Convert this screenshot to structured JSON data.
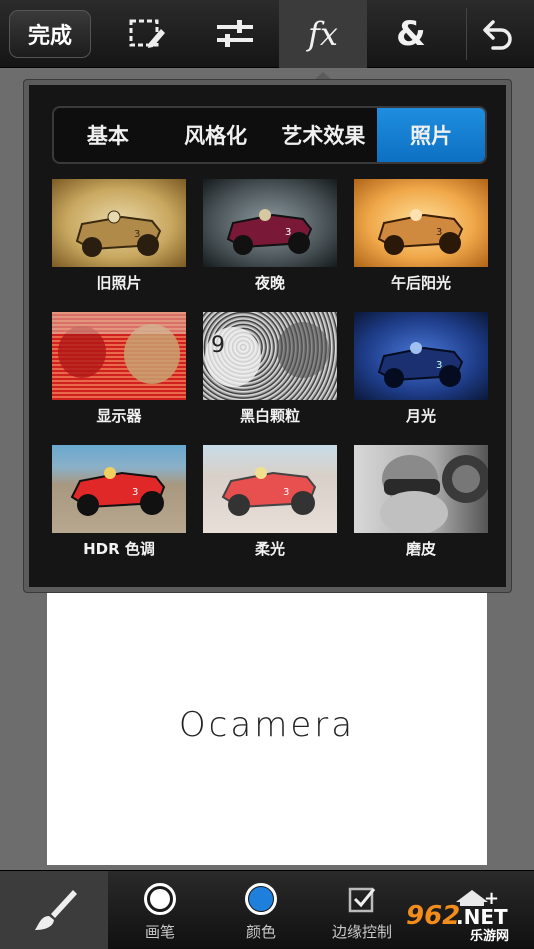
{
  "toolbar": {
    "done_label": "完成",
    "tools": [
      {
        "icon": "select-crop-icon",
        "active": false
      },
      {
        "icon": "adjust-sliders-icon",
        "active": false
      },
      {
        "icon": "fx-icon",
        "label": "fx",
        "active": true
      },
      {
        "icon": "ampersand-icon",
        "label": "&",
        "active": false
      },
      {
        "icon": "undo-icon",
        "active": false
      }
    ]
  },
  "popup": {
    "tabs": [
      {
        "label": "基本",
        "active": false
      },
      {
        "label": "风格化",
        "active": false
      },
      {
        "label": "艺术效果",
        "active": false
      },
      {
        "label": "照片",
        "active": true
      }
    ],
    "effects": [
      {
        "label": "旧照片"
      },
      {
        "label": "夜晚"
      },
      {
        "label": "午后阳光"
      },
      {
        "label": "显示器"
      },
      {
        "label": "黑白颗粒"
      },
      {
        "label": "月光"
      },
      {
        "label": "HDR 色调"
      },
      {
        "label": "柔光"
      },
      {
        "label": "磨皮"
      }
    ]
  },
  "canvas": {
    "text": "Ocamera"
  },
  "bottom": {
    "items": [
      {
        "label": "画笔",
        "icon": "brush-circle-icon"
      },
      {
        "label": "颜色",
        "icon": "color-circle-icon",
        "color": "#1e7fdc"
      },
      {
        "label": "边缘控制",
        "icon": "edge-check-icon"
      }
    ],
    "add_label": "+"
  },
  "watermark": {
    "line1": "962",
    "line1b": ".NET",
    "line2": "乐游网"
  },
  "colors": {
    "accent": "#1a84d6",
    "toolbar_bg": "#1e1e1e",
    "popup_bg": "#151515"
  }
}
